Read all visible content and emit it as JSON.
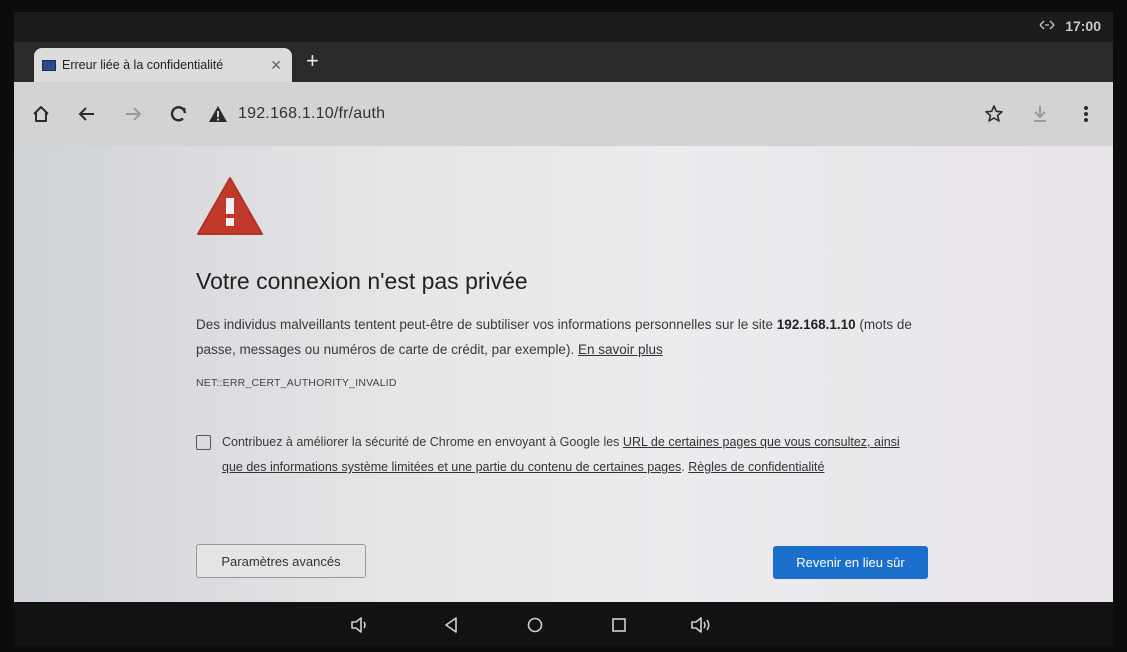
{
  "status": {
    "time": "17:00",
    "network_icon": "network-transfer-icon"
  },
  "tab": {
    "title": "Erreur liée à la confidentialité",
    "close": "✕"
  },
  "toolbar": {
    "url": "192.168.1.10/fr/auth"
  },
  "page": {
    "heading": "Votre connexion n'est pas privée",
    "desc_part1": "Des individus malveillants tentent peut-être de subtiliser vos informations personnelles sur le site ",
    "desc_host": "192.168.1.10",
    "desc_part2": " (mots de passe, messages ou numéros de carte de crédit, par exemple). ",
    "learn_more": "En savoir plus",
    "error_code": "NET::ERR_CERT_AUTHORITY_INVALID",
    "optin_prefix": "Contribuez à améliorer la sécurité de Chrome en envoyant à Google les ",
    "optin_link": "URL de certaines pages que vous consultez, ainsi que des informations système limitées et une partie du contenu de certaines pages",
    "optin_sep": ". ",
    "privacy_link": "Règles de confidentialité",
    "advanced_button": "Paramètres avancés",
    "back_button": "Revenir en lieu sûr"
  },
  "colors": {
    "accent": "#1a6fcc",
    "warning": "#c0392b"
  }
}
